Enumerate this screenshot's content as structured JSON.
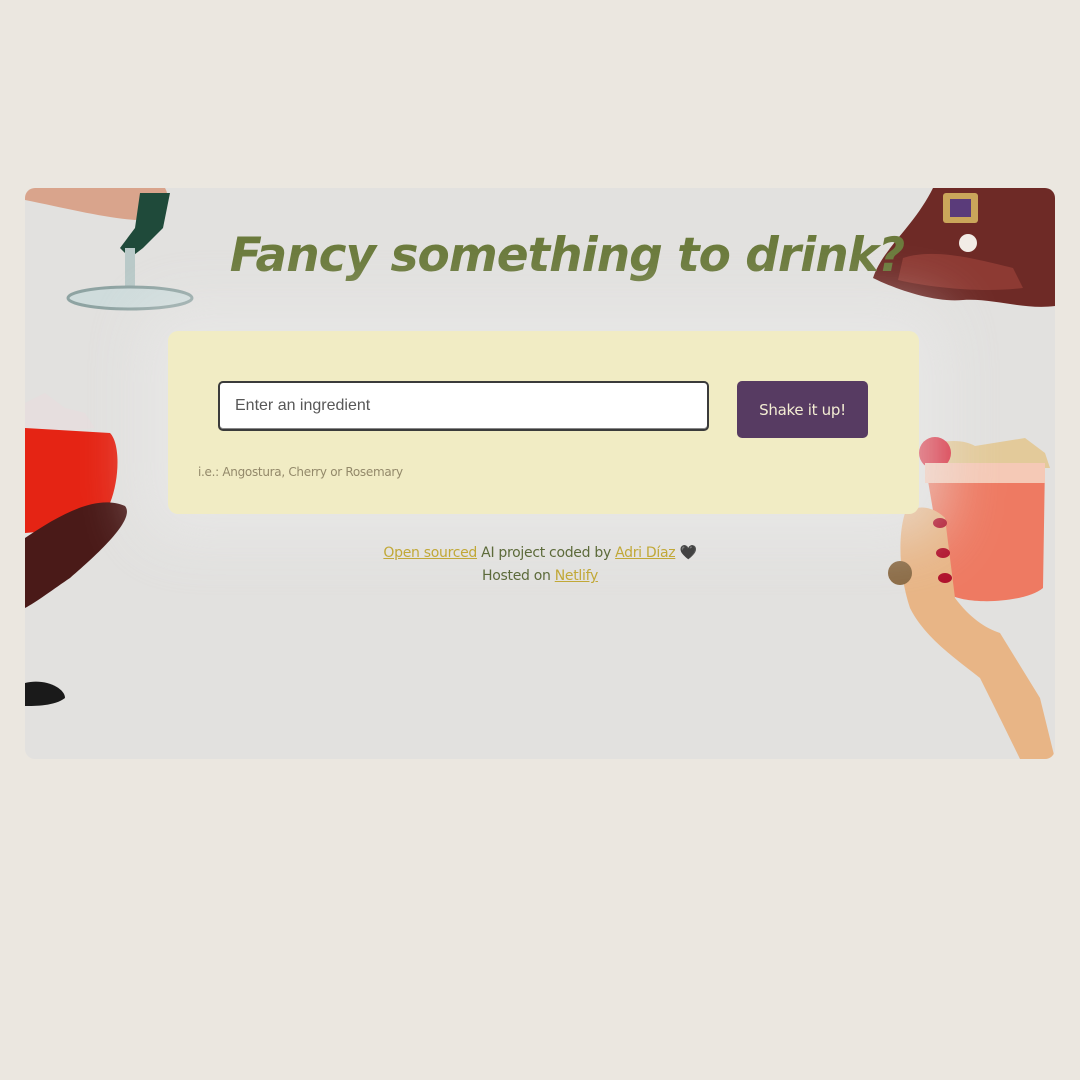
{
  "page": {
    "title": "Fancy something to drink?"
  },
  "search": {
    "placeholder": "Enter an ingredient",
    "value": "",
    "button_label": "Shake it up!",
    "hint": "i.e.: Angostura, Cherry or Rosemary"
  },
  "footer": {
    "line1_link1": "Open sourced",
    "line1_text1": " AI project coded by ",
    "line1_link2": "Adri Díaz",
    "line1_heart": " 🖤",
    "line2_text": "Hosted on ",
    "line2_link": "Netlify"
  },
  "colors": {
    "background": "#ebe7e0",
    "card": "#e2e1df",
    "title": "#6b7a3c",
    "panel": "#f1ecc4",
    "button": "#573b62",
    "button_text": "#f3edd3",
    "link": "#c1a837",
    "footer_text": "#5c6a3a"
  }
}
